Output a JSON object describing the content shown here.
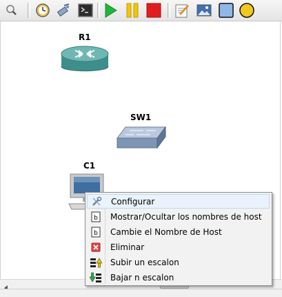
{
  "toolbar": {
    "tools": [
      "inspect-icon",
      "clock-icon",
      "config-wand-icon",
      "terminal-icon",
      "play-icon",
      "pause-icon",
      "stop-icon",
      "notepad-icon",
      "image-icon",
      "rectangle-icon",
      "ellipse-icon"
    ],
    "colors": {
      "play": "#22b43c",
      "pause": "#f2c40a",
      "stop": "#e11e1e",
      "rectangle": "#8fb8e8",
      "ellipse": "#f0c81e"
    }
  },
  "devices": [
    {
      "name": "R1",
      "type": "router-icon"
    },
    {
      "name": "SW1",
      "type": "switch-icon"
    },
    {
      "name": "C1",
      "type": "computer-icon"
    }
  ],
  "context_menu": {
    "items": [
      {
        "label": "Configurar",
        "icon": "wrench-icon"
      },
      {
        "label": "Mostrar/Ocultar los nombres de host",
        "icon": "hostname-icon"
      },
      {
        "label": "Cambie el Nombre de Host",
        "icon": "hostname-icon"
      },
      {
        "label": "Eliminar",
        "icon": "delete-icon"
      },
      {
        "label": "Subir un escalon",
        "icon": "raise-layer-icon"
      },
      {
        "label": "Bajar n escalon",
        "icon": "lower-layer-icon"
      }
    ]
  }
}
